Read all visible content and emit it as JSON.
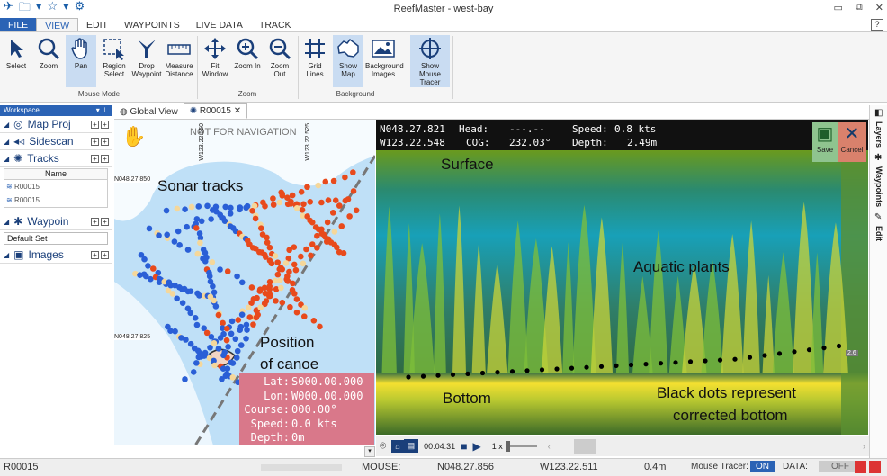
{
  "window": {
    "title": "ReefMaster - west-bay"
  },
  "menu": {
    "file": "FILE",
    "view": "VIEW",
    "edit": "EDIT",
    "waypoints": "WAYPOINTS",
    "live_data": "LIVE DATA",
    "track": "TRACK",
    "help": "?"
  },
  "ribbon": {
    "select": "Select",
    "zoom": "Zoom",
    "pan": "Pan",
    "region_select": "Region Select",
    "drop_waypoint": "Drop Waypoint",
    "measure_distance": "Measure Distance",
    "fit_window": "Fit Window",
    "zoom_in": "Zoom In",
    "zoom_out": "Zoom Out",
    "grid_lines": "Grid Lines",
    "show_map": "Show Map",
    "background_images": "Background Images",
    "show_mouse_tracer": "Show Mouse Tracer",
    "group_mouse_mode": "Mouse Mode",
    "group_zoom": "Zoom",
    "group_background": "Background"
  },
  "sidebar": {
    "workspace": "Workspace",
    "map_proj": "Map Proj",
    "sidescan": "Sidescan",
    "tracks": "Tracks",
    "tracks_col": "Name",
    "track_rows": [
      "R00015",
      "R00015"
    ],
    "waypoints": "Waypoin",
    "default_set": "Default Set",
    "images": "Images"
  },
  "tabs": {
    "global_view": "Global View",
    "active": "R00015"
  },
  "map": {
    "not_for_nav": "NOT FOR NAVIGATION",
    "lat_top": "N048.27.850",
    "lat_bottom": "N048.27.825",
    "lon_left": "W123.22.550",
    "lon_right": "W123.22.525",
    "annotation_tracks": "Sonar tracks",
    "annotation_position": "Position",
    "annotation_canoe": "of canoe",
    "nav": {
      "lat_label": "Lat:",
      "lat_value": "S000.00.000",
      "lon_label": "Lon:",
      "lon_value": "W000.00.000",
      "course_label": "Course:",
      "course_value": "000.00°",
      "speed_label": "Speed:",
      "speed_value": "0.0 kts",
      "depth_label": "Depth:",
      "depth_value": "0m"
    }
  },
  "sonar": {
    "lat": "N048.27.821",
    "lon": "W123.22.548",
    "head_label": "Head:",
    "head_value": "---.--",
    "cog_label": "COG:",
    "cog_value": "232.03°",
    "speed_label": "Speed:",
    "speed_value": "0.8 kts",
    "depth_label": "Depth:",
    "depth_value": "2.49m",
    "save": "Save",
    "cancel": "Cancel",
    "depth_marker": "2.6",
    "annotation_surface": "Surface",
    "annotation_plants": "Aquatic plants",
    "annotation_bottom": "Bottom",
    "annotation_dots_1": "Black dots represent",
    "annotation_dots_2": "corrected bottom"
  },
  "player": {
    "time": "00:04:31",
    "speed": "1 x"
  },
  "rightbar": {
    "layers": "Layers",
    "waypoints": "Waypoints",
    "edit": "Edit"
  },
  "status": {
    "track": "R00015",
    "mouse_label": "MOUSE:",
    "mouse_lat": "N048.27.856",
    "mouse_lon": "W123.22.511",
    "mouse_depth": "0.4m",
    "tracer_label": "Mouse Tracer:",
    "tracer_state": "ON",
    "data_label": "DATA:",
    "data_state": "OFF"
  },
  "colors": {
    "accent": "#2b63b5",
    "nav_panel": "#d9788a",
    "track_hot": "#e84a1c",
    "track_cold": "#2a5fd6"
  }
}
